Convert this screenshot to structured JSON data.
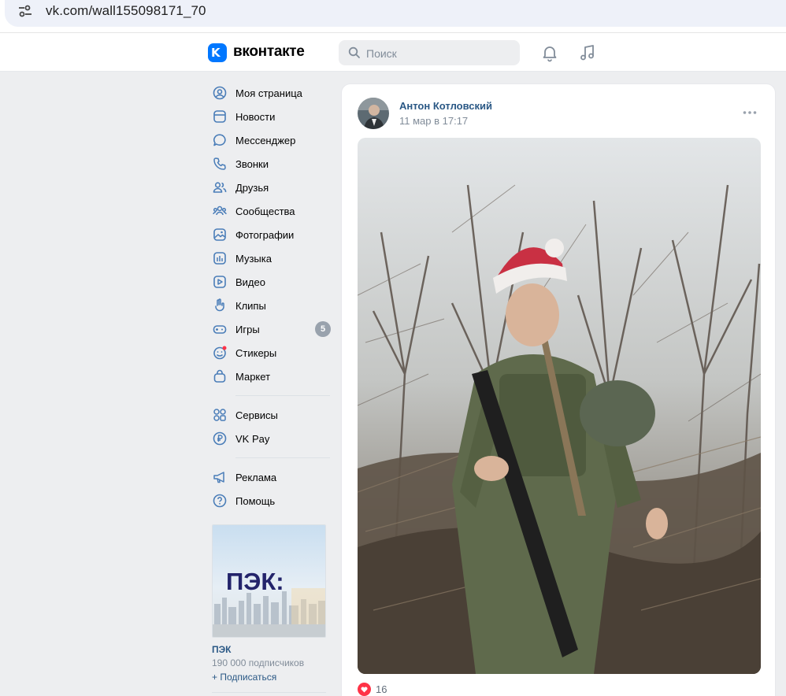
{
  "browser": {
    "url": "vk.com/wall155098171_70"
  },
  "header": {
    "logo_glyph": "K",
    "logo_text": "вконтакте",
    "search_placeholder": "Поиск",
    "icons": [
      "bell-icon",
      "music-note-icon"
    ]
  },
  "sidebar": {
    "items": [
      {
        "label": "Моя страница",
        "icon": "user-circle-icon"
      },
      {
        "label": "Новости",
        "icon": "newsfeed-icon"
      },
      {
        "label": "Мессенджер",
        "icon": "message-bubble-icon"
      },
      {
        "label": "Звонки",
        "icon": "phone-icon"
      },
      {
        "label": "Друзья",
        "icon": "friends-icon"
      },
      {
        "label": "Сообщества",
        "icon": "communities-icon"
      },
      {
        "label": "Фотографии",
        "icon": "photo-icon"
      },
      {
        "label": "Музыка",
        "icon": "music-icon"
      },
      {
        "label": "Видео",
        "icon": "video-icon"
      },
      {
        "label": "Клипы",
        "icon": "clips-icon"
      },
      {
        "label": "Игры",
        "icon": "gamepad-icon",
        "badge": "5"
      },
      {
        "label": "Стикеры",
        "icon": "sticker-smile-icon"
      },
      {
        "label": "Маркет",
        "icon": "shopping-bag-icon"
      },
      {
        "label": "Сервисы",
        "icon": "services-grid-icon"
      },
      {
        "label": "VK Pay",
        "icon": "ruble-coin-icon"
      },
      {
        "label": "Реклама",
        "icon": "megaphone-icon"
      },
      {
        "label": "Помощь",
        "icon": "help-circle-icon"
      }
    ],
    "promo": {
      "logo_text": "ПЭК:",
      "name": "ПЭК",
      "subscribers": "190 000 подписчиков",
      "subscribe_label": "+ Подписаться"
    }
  },
  "post": {
    "author": "Антон Котловский",
    "date": "11 мар в 17:17",
    "likes": "16"
  },
  "colors": {
    "vk_blue": "#0077ff",
    "link": "#2a5885",
    "muted": "#818c99",
    "page_bg": "#edeef0",
    "icon_blue": "#4a7db8",
    "like_red": "#ff3347"
  }
}
